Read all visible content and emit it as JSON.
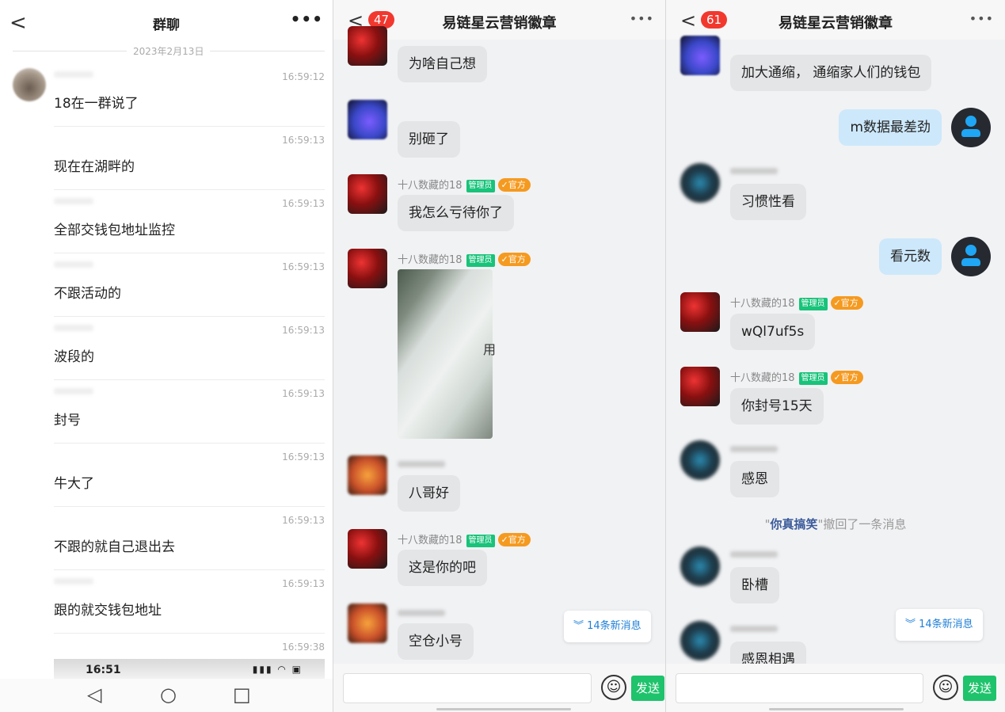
{
  "panel1": {
    "back": "<",
    "title": "群聊",
    "more": "•••",
    "date": "2023年2月13日",
    "rows": [
      {
        "time": "16:59:12",
        "text": "18在一群说了"
      },
      {
        "time": "16:59:13",
        "text": "现在在湖畔的"
      },
      {
        "time": "16:59:13",
        "text": "全部交钱包地址监控"
      },
      {
        "time": "16:59:13",
        "text": "不跟活动的"
      },
      {
        "time": "16:59:13",
        "text": "波段的"
      },
      {
        "time": "16:59:13",
        "text": "封号"
      },
      {
        "time": "16:59:13",
        "text": "牛大了"
      },
      {
        "time": "16:59:13",
        "text": "不跟的就自己退出去"
      },
      {
        "time": "16:59:13",
        "text": "跟的就交钱包地址"
      },
      {
        "time": "16:59:38",
        "text": ""
      }
    ],
    "shot_time": "16:51",
    "shot_icons": "▮▮▮ ◠ ▣",
    "nav": {
      "back": "◁",
      "home": "○",
      "recent": "□"
    }
  },
  "panel2": {
    "back": "<",
    "badge": "47",
    "title": "易链星云营销徽章",
    "more": "•••",
    "messages": [
      {
        "sender": "",
        "text": "为啥自己想"
      },
      {
        "sender": "",
        "text": "别砸了"
      },
      {
        "sender": "十八数藏的18",
        "admin": "管理员",
        "official": "官方",
        "text": "我怎么亏待你了"
      },
      {
        "sender": "十八数藏的18",
        "admin": "管理员",
        "official": "官方",
        "image_text": "用"
      },
      {
        "sender": "",
        "text": "八哥好"
      },
      {
        "sender": "十八数藏的18",
        "admin": "管理员",
        "official": "官方",
        "text": "这是你的吧"
      },
      {
        "sender": "",
        "text": "空仓小号"
      }
    ],
    "new_messages": "14条新消息",
    "emoji": "☺",
    "send": "发送"
  },
  "panel3": {
    "back": "<",
    "badge": "61",
    "title": "易链星云营销徽章",
    "more": "•••",
    "messages": [
      {
        "sender": "",
        "text": "加大通缩， 通缩家人们的钱包"
      },
      {
        "self": true,
        "text": "m数据最差劲"
      },
      {
        "sender": "",
        "text": "习惯性看"
      },
      {
        "self": true,
        "text": "看元数"
      },
      {
        "sender": "十八数藏的18",
        "admin": "管理员",
        "official": "官方",
        "text": "wQl7uf5s"
      },
      {
        "sender": "十八数藏的18",
        "admin": "管理员",
        "official": "官方",
        "text": "你封号15天"
      },
      {
        "sender": "",
        "text": "感恩"
      },
      {
        "sender": "",
        "text": "卧槽"
      },
      {
        "sender": "",
        "text": "感恩相遇"
      }
    ],
    "recall": {
      "name": "你真搞笑",
      "quote_open": "\"",
      "quote_close": "\"",
      "suffix": "撤回了一条消息"
    },
    "new_messages": "14条新消息",
    "emoji": "☺",
    "send": "发送"
  }
}
